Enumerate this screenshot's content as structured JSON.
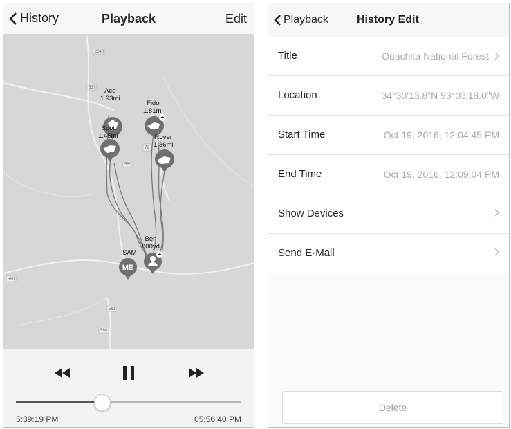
{
  "playback": {
    "nav": {
      "back_label": "History",
      "title": "Playback",
      "edit_label": "Edit"
    },
    "map": {
      "road_labels": [
        "2340",
        "537",
        "559",
        "72",
        "560",
        "561",
        "560"
      ],
      "markers": [
        {
          "name": "Ace",
          "distance": "1.93mi",
          "icon": "dog-icon"
        },
        {
          "name": "Fido",
          "distance": "1.81mi",
          "icon": "dog-icon"
        },
        {
          "name": "Spot",
          "distance": "1.45mi",
          "icon": "dog-icon"
        },
        {
          "name": "Rover",
          "distance": "1.36mi",
          "icon": "dog-icon"
        },
        {
          "name": "Ben",
          "distance": "800yd",
          "icon": "person-icon"
        },
        {
          "name": "SAM",
          "badge": "ME",
          "icon": "me-badge"
        }
      ]
    },
    "controls": {
      "rewind_icon": "rewind-icon",
      "pause_icon": "pause-icon",
      "forward_icon": "fast-forward-icon",
      "progress": 0.38,
      "start_time": "5:39:19 PM",
      "end_time": "05:56:40 PM"
    }
  },
  "history_edit": {
    "nav": {
      "back_label": "Playback",
      "title": "History Edit"
    },
    "rows": [
      {
        "label": "Title",
        "value": "Ouachita National Forest",
        "chevron": true
      },
      {
        "label": "Location",
        "value": "34°30'13.8\"N 93°03'18.0\"W",
        "chevron": false
      },
      {
        "label": "Start Time",
        "value": "Oct 19, 2016, 12:04:45 PM",
        "chevron": false
      },
      {
        "label": "End Time",
        "value": "Oct 19, 2016, 12:09:04 PM",
        "chevron": false
      },
      {
        "label": "Show Devices",
        "value": "",
        "chevron": true
      },
      {
        "label": "Send E-Mail",
        "value": "",
        "chevron": true
      }
    ],
    "delete_label": "Delete"
  },
  "colors": {
    "marker": "#6f6f6f",
    "map_bg": "#d7d7d7",
    "track": "#7a7a7a"
  }
}
